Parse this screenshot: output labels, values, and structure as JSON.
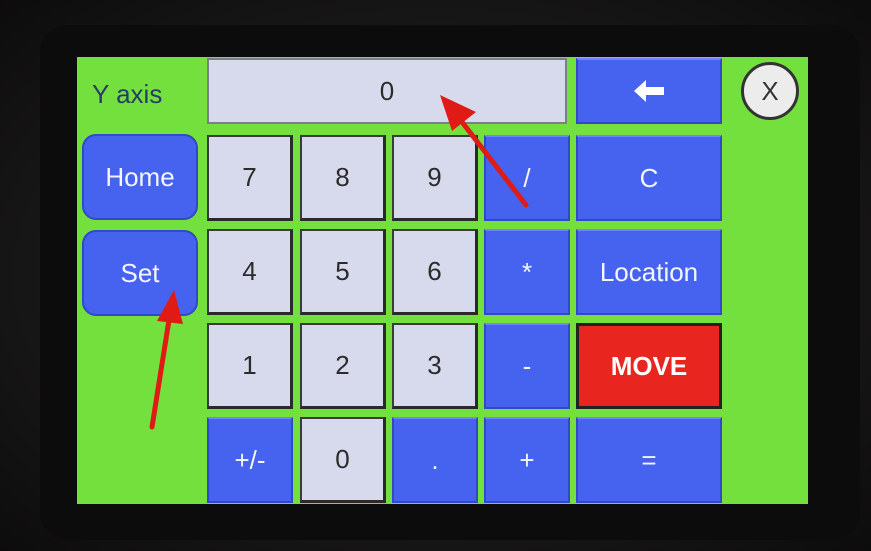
{
  "colors": {
    "screen_bg": "#73e03e",
    "key_light": "#d7d9ec",
    "key_blue": "#4663f0",
    "key_red": "#e8251f",
    "annotation_arrow": "#e01b15"
  },
  "header": {
    "axis_label": "Y axis",
    "display_value": "0",
    "backspace_icon": "left-arrow-icon",
    "close_label": "X"
  },
  "side": {
    "home_label": "Home",
    "set_label": "Set"
  },
  "keypad": {
    "k7": "7",
    "k8": "8",
    "k9": "9",
    "div": "/",
    "k4": "4",
    "k5": "5",
    "k6": "6",
    "mul": "*",
    "k1": "1",
    "k2": "2",
    "k3": "3",
    "sub": "-",
    "sign": "+/-",
    "k0": "0",
    "dot": ".",
    "add": "+"
  },
  "actions": {
    "clear_label": "C",
    "location_label": "Location",
    "move_label": "MOVE",
    "equals_label": "="
  }
}
